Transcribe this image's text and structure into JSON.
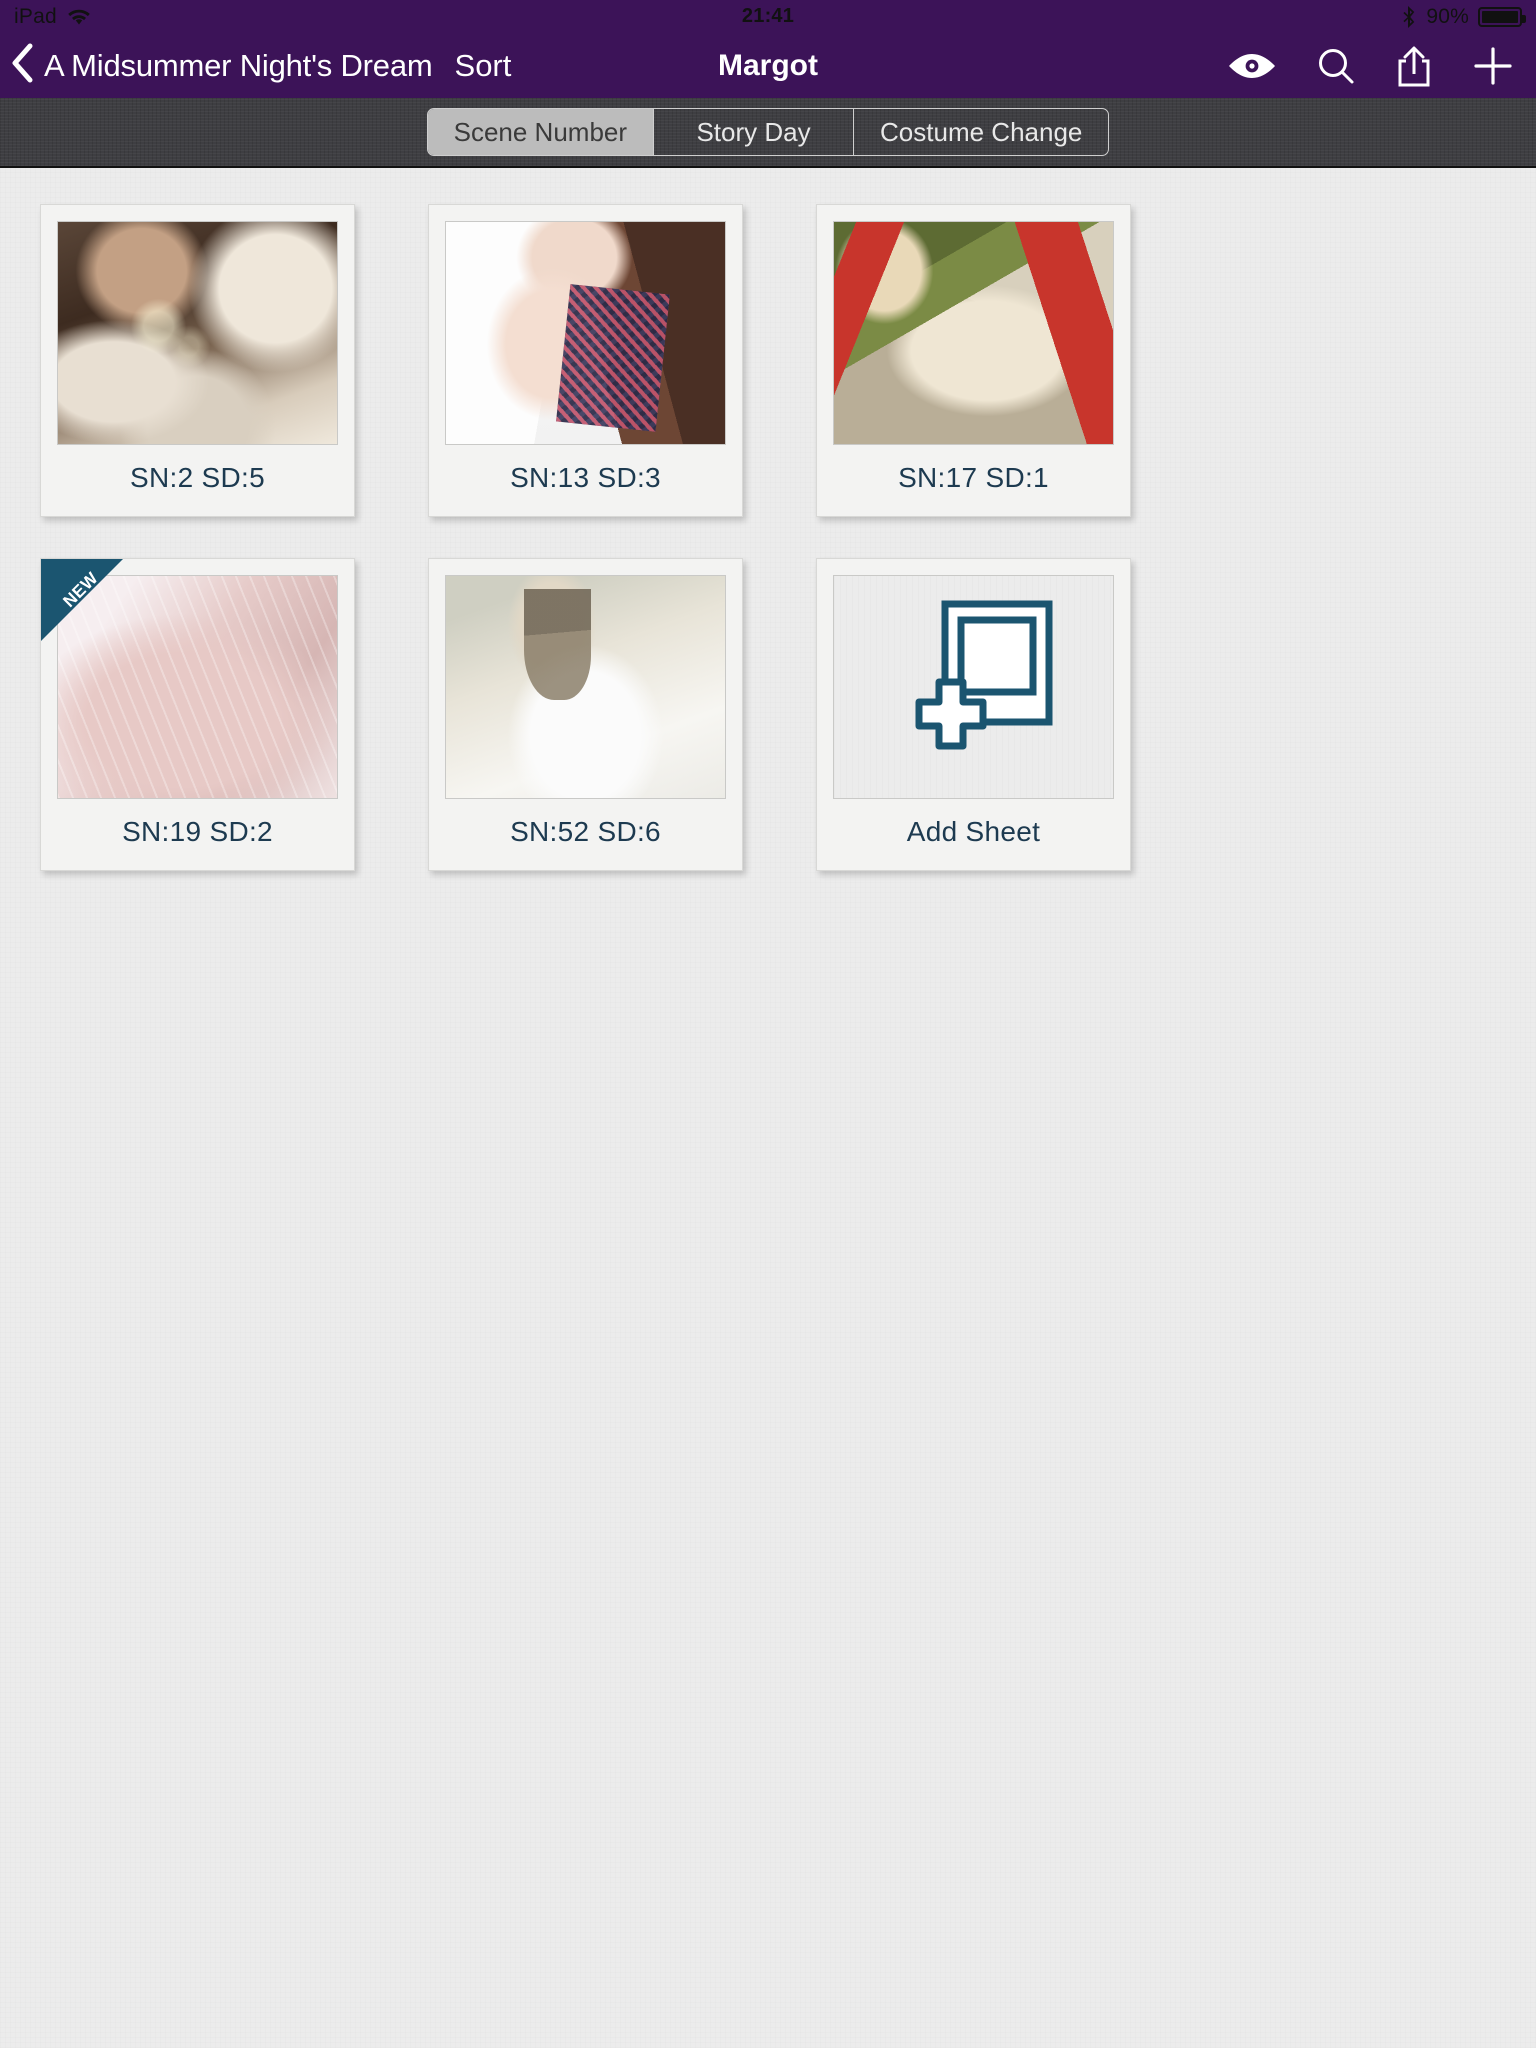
{
  "statusbar": {
    "device": "iPad",
    "wifi_icon": "wifi-icon",
    "time": "21:41",
    "bluetooth_icon": "bluetooth-icon",
    "battery_percent": "90%",
    "battery_icon": "battery-full-icon"
  },
  "navbar": {
    "back_icon": "chevron-left-icon",
    "back_label": "A Midsummer Night's Dream",
    "sort_label": "Sort",
    "title": "Margot",
    "actions": [
      {
        "name": "eye-icon",
        "label": "View"
      },
      {
        "name": "search-icon",
        "label": "Search"
      },
      {
        "name": "share-icon",
        "label": "Share"
      },
      {
        "name": "plus-icon",
        "label": "Add"
      }
    ]
  },
  "segmented": {
    "selected": "Scene Number",
    "options": [
      "Scene Number",
      "Story Day",
      "Costume Change"
    ]
  },
  "cards": [
    {
      "caption": "SN:2 SD:5",
      "art": "art-fur",
      "new": false
    },
    {
      "caption": "SN:13 SD:3",
      "art": "art-lady",
      "new": false
    },
    {
      "caption": "SN:17 SD:1",
      "art": "art-red",
      "new": false
    },
    {
      "caption": "SN:19 SD:2",
      "art": "art-pink",
      "new": true,
      "badge": "NEW"
    },
    {
      "caption": "SN:52 SD:6",
      "art": "art-white",
      "new": false
    }
  ],
  "add_card": {
    "caption": "Add Sheet",
    "icon": "add-sheet-icon"
  },
  "colors": {
    "navbar_purple": "#3c1358",
    "toolbar_dark": "#3e3e42",
    "caption_navy": "#1d3a50",
    "ribbon_teal": "#1b5570",
    "content_bg": "#ececec"
  }
}
